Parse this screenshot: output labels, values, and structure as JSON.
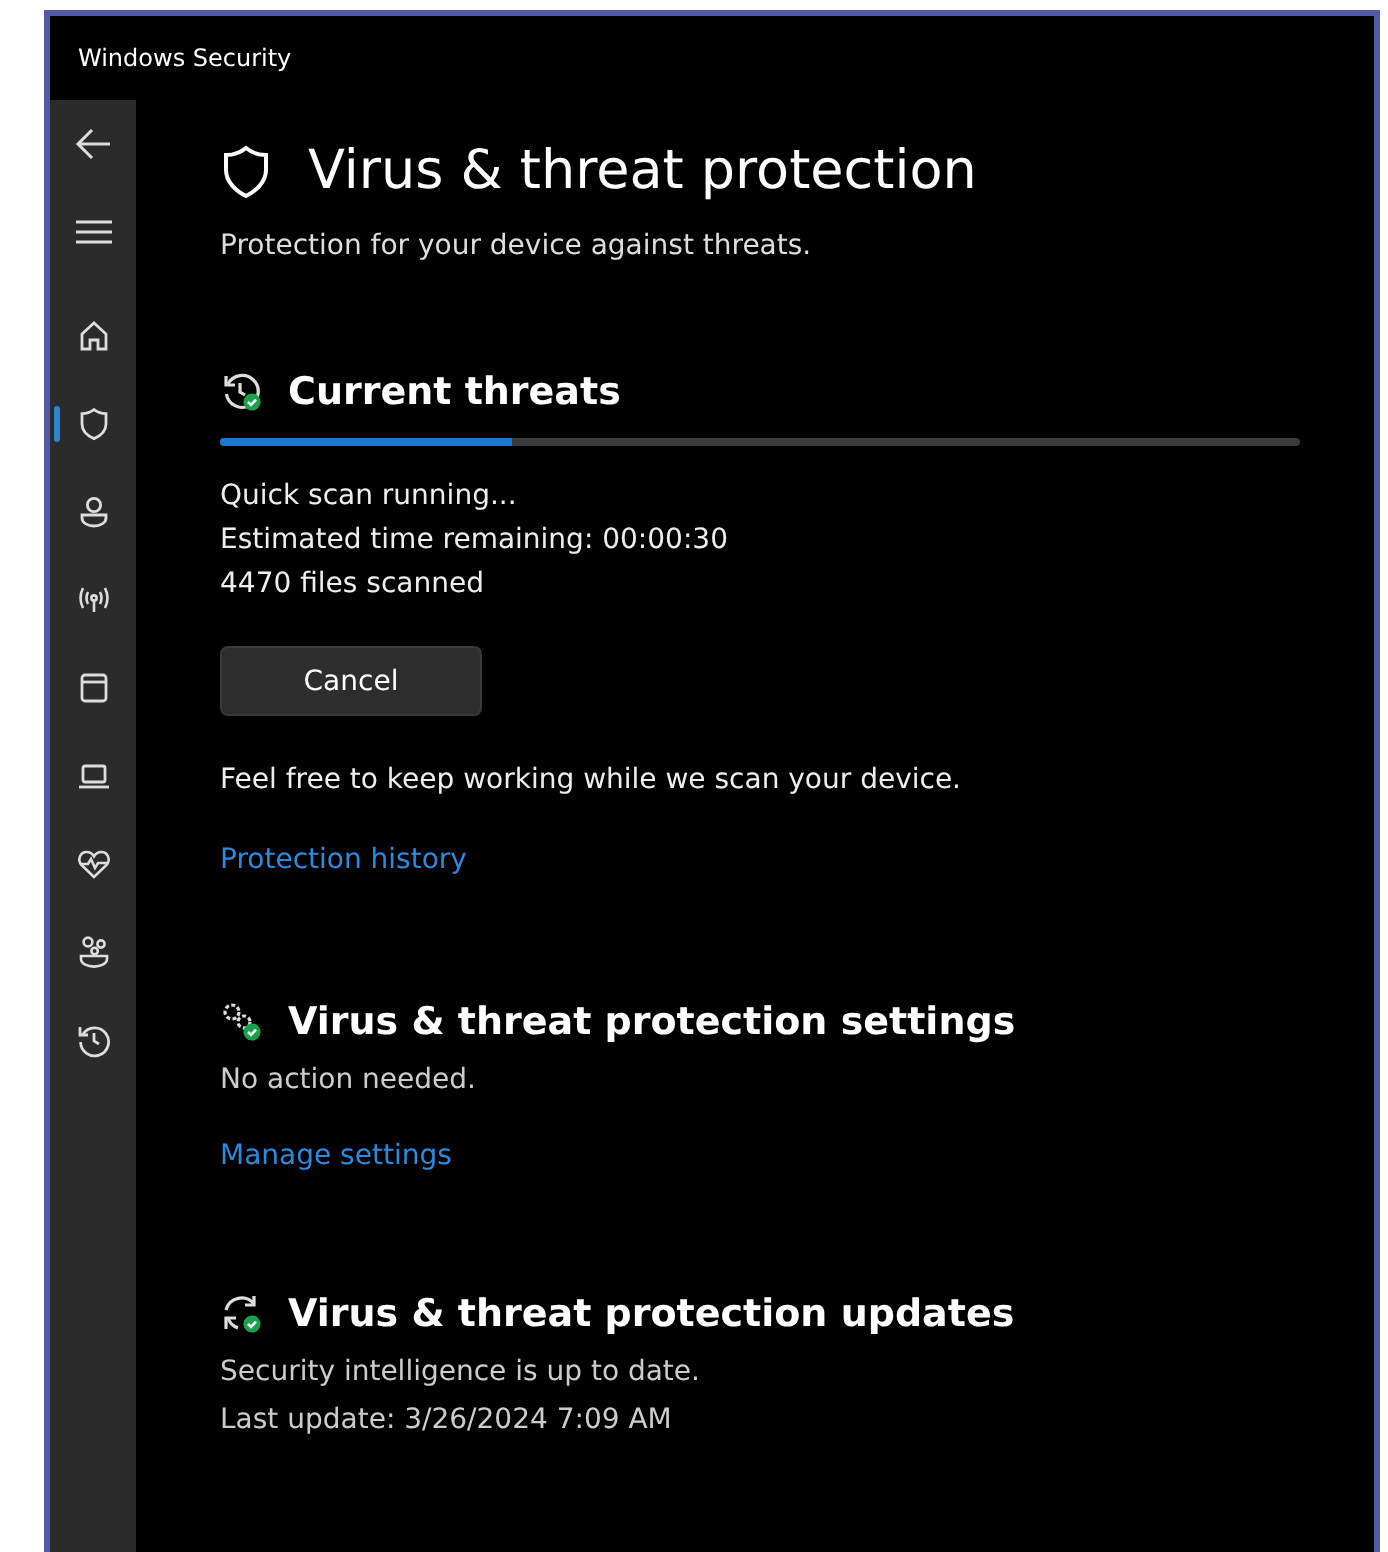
{
  "window": {
    "title": "Windows Security"
  },
  "sidebar": {
    "items": [
      {
        "kind": "home",
        "selected": false
      },
      {
        "kind": "shield",
        "selected": true
      },
      {
        "kind": "account",
        "selected": false
      },
      {
        "kind": "network",
        "selected": false
      },
      {
        "kind": "app",
        "selected": false
      },
      {
        "kind": "device",
        "selected": false
      },
      {
        "kind": "health",
        "selected": false
      },
      {
        "kind": "family",
        "selected": false
      },
      {
        "kind": "history",
        "selected": false
      }
    ]
  },
  "page": {
    "title": "Virus & threat protection",
    "subtitle": "Protection for your device against threats."
  },
  "current_threats": {
    "title": "Current threats",
    "level": 0.27,
    "status_lines": [
      "Quick scan running...",
      "Estimated time remaining:  00:00:30",
      "4470  files scanned"
    ],
    "button": "Cancel",
    "note": "Feel free to keep working while we scan your device.",
    "link": "Protection history"
  },
  "sections": [
    {
      "kind": "settings",
      "title": "Virus & threat protection settings",
      "lines": [
        "No action needed."
      ],
      "link": "Manage settings"
    },
    {
      "kind": "updates",
      "title": "Virus & threat protection updates",
      "lines": [
        "Security intelligence is up to date.",
        "Last update: 3/26/2024 7:09 AM"
      ]
    }
  ]
}
